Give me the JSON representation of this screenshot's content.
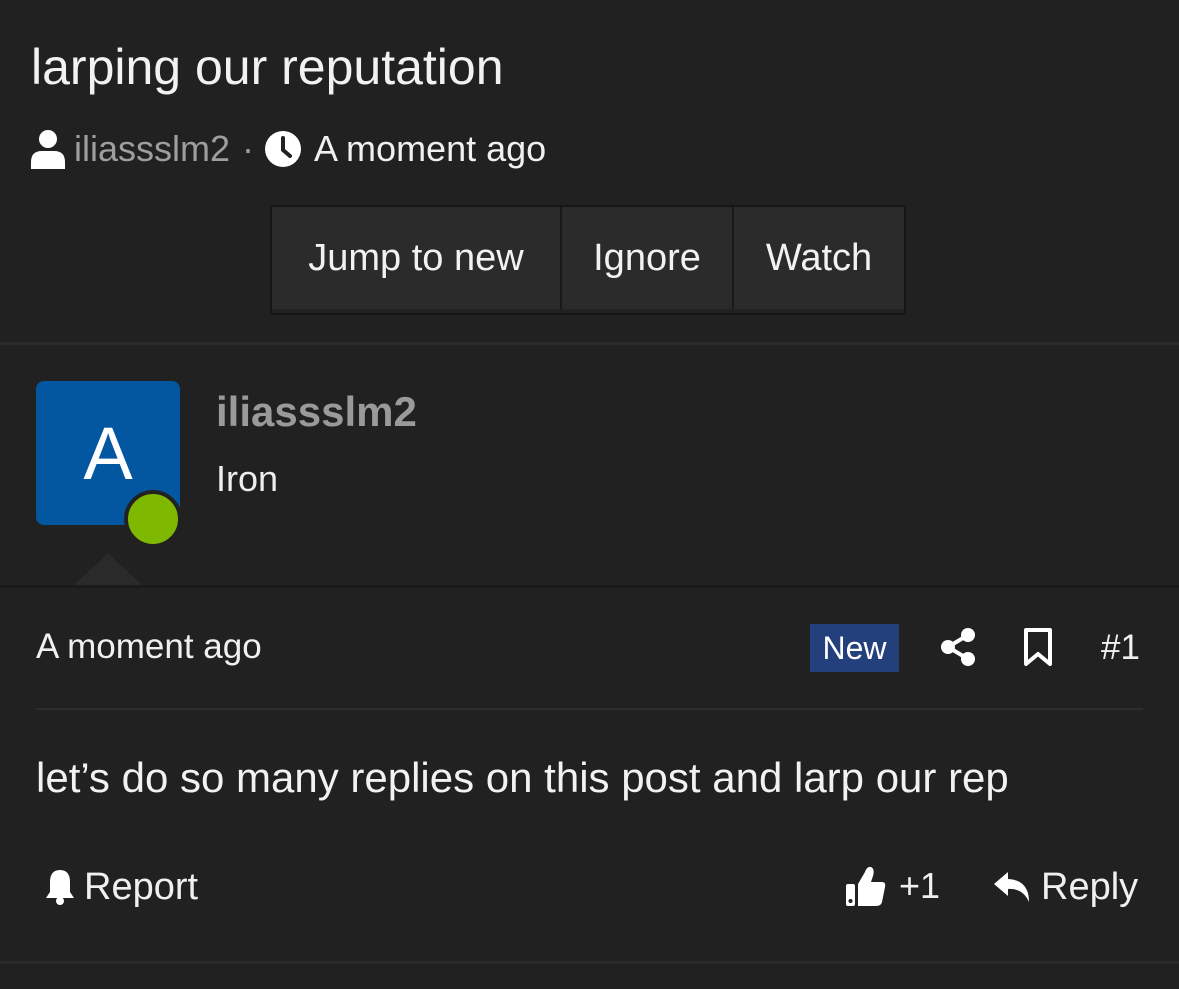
{
  "thread": {
    "title": "larping our reputation",
    "author": "iliassslm2",
    "separator": "·",
    "time": "A moment ago"
  },
  "actions": {
    "jump_to_new": "Jump to new",
    "ignore": "Ignore",
    "watch": "Watch"
  },
  "post": {
    "avatar_letter": "A",
    "avatar_color": "#0357a1",
    "online_color": "#7fb800",
    "username": "iliassslm2",
    "user_title": "Iron",
    "time": "A moment ago",
    "badge": "New",
    "badge_color": "#233f7c",
    "number": "#1",
    "text": "let’s do so many replies on this post and larp our rep",
    "report_label": "Report",
    "like_count": "+1",
    "reply_label": "Reply",
    "icons": [
      "user-icon",
      "clock-icon",
      "share-icon",
      "bookmark-icon",
      "bell-icon",
      "thumbs-up-icon",
      "reply-icon"
    ]
  }
}
